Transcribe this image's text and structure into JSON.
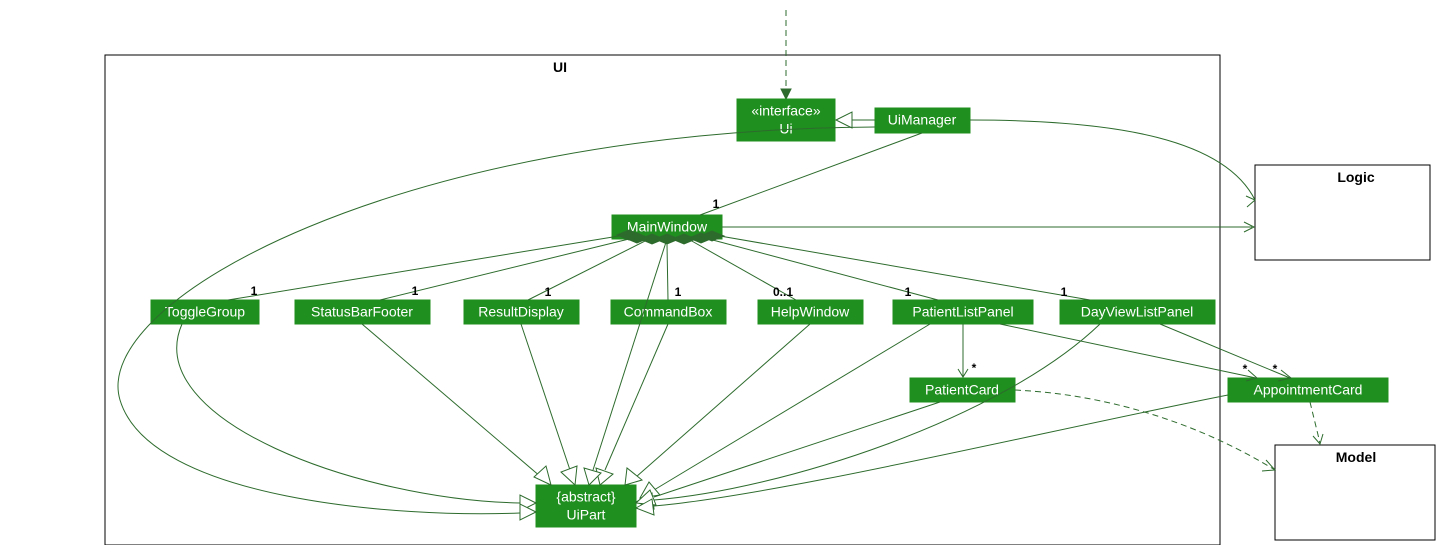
{
  "chart_data": {
    "type": "uml-class-diagram",
    "packages": [
      {
        "id": "UI",
        "label": "UI"
      },
      {
        "id": "Logic",
        "label": "Logic"
      },
      {
        "id": "Model",
        "label": "Model"
      }
    ],
    "classes": [
      {
        "id": "Ui",
        "stereotype": "«interface»",
        "name": "Ui",
        "package": "UI"
      },
      {
        "id": "UiManager",
        "name": "UiManager",
        "package": "UI"
      },
      {
        "id": "MainWindow",
        "name": "MainWindow",
        "package": "UI"
      },
      {
        "id": "ToggleGroup",
        "name": "ToggleGroup",
        "package": "UI"
      },
      {
        "id": "StatusBarFooter",
        "name": "StatusBarFooter",
        "package": "UI"
      },
      {
        "id": "ResultDisplay",
        "name": "ResultDisplay",
        "package": "UI"
      },
      {
        "id": "CommandBox",
        "name": "CommandBox",
        "package": "UI"
      },
      {
        "id": "HelpWindow",
        "name": "HelpWindow",
        "package": "UI"
      },
      {
        "id": "PatientListPanel",
        "name": "PatientListPanel",
        "package": "UI"
      },
      {
        "id": "DayViewListPanel",
        "name": "DayViewListPanel",
        "package": "UI"
      },
      {
        "id": "PatientCard",
        "name": "PatientCard",
        "package": "UI"
      },
      {
        "id": "AppointmentCard",
        "name": "AppointmentCard",
        "package": null
      },
      {
        "id": "UiPart",
        "stereotype": "{abstract}",
        "name": "UiPart",
        "package": "UI"
      }
    ],
    "edges": [
      {
        "from": "outside",
        "to": "Ui",
        "type": "dependency"
      },
      {
        "from": "UiManager",
        "to": "Ui",
        "type": "realization"
      },
      {
        "from": "UiManager",
        "to": "MainWindow",
        "type": "association",
        "mult_to": "1"
      },
      {
        "from": "UiManager",
        "to": "Logic",
        "type": "navigable"
      },
      {
        "from": "MainWindow",
        "to": "Logic",
        "type": "navigable"
      },
      {
        "from": "MainWindow",
        "to": "ToggleGroup",
        "type": "composition",
        "mult_to": "1"
      },
      {
        "from": "MainWindow",
        "to": "StatusBarFooter",
        "type": "composition",
        "mult_to": "1"
      },
      {
        "from": "MainWindow",
        "to": "ResultDisplay",
        "type": "composition",
        "mult_to": "1"
      },
      {
        "from": "MainWindow",
        "to": "CommandBox",
        "type": "composition",
        "mult_to": "1"
      },
      {
        "from": "MainWindow",
        "to": "HelpWindow",
        "type": "composition",
        "mult_to": "0..1"
      },
      {
        "from": "MainWindow",
        "to": "PatientListPanel",
        "type": "composition",
        "mult_to": "1"
      },
      {
        "from": "MainWindow",
        "to": "DayViewListPanel",
        "type": "composition",
        "mult_to": "1"
      },
      {
        "from": "PatientListPanel",
        "to": "PatientCard",
        "type": "navigable",
        "mult_to": "*"
      },
      {
        "from": "PatientListPanel",
        "to": "AppointmentCard",
        "type": "navigable",
        "mult_to": "*"
      },
      {
        "from": "DayViewListPanel",
        "to": "AppointmentCard",
        "type": "navigable",
        "mult_to": "*"
      },
      {
        "from": "PatientCard",
        "to": "Model",
        "type": "dependency"
      },
      {
        "from": "AppointmentCard",
        "to": "Model",
        "type": "dependency"
      },
      {
        "from": "MainWindow",
        "to": "UiPart",
        "type": "generalization"
      },
      {
        "from": "StatusBarFooter",
        "to": "UiPart",
        "type": "generalization"
      },
      {
        "from": "ResultDisplay",
        "to": "UiPart",
        "type": "generalization"
      },
      {
        "from": "CommandBox",
        "to": "UiPart",
        "type": "generalization"
      },
      {
        "from": "HelpWindow",
        "to": "UiPart",
        "type": "generalization"
      },
      {
        "from": "PatientListPanel",
        "to": "UiPart",
        "type": "generalization"
      },
      {
        "from": "DayViewListPanel",
        "to": "UiPart",
        "type": "generalization"
      },
      {
        "from": "PatientCard",
        "to": "UiPart",
        "type": "generalization"
      },
      {
        "from": "AppointmentCard",
        "to": "UiPart",
        "type": "generalization"
      },
      {
        "from": "ToggleGroup",
        "to": "UiPart",
        "type": "generalization"
      },
      {
        "from": "UiManager",
        "to": "UiPart",
        "type": "generalization"
      }
    ]
  },
  "packages": {
    "ui": "UI",
    "logic": "Logic",
    "model": "Model"
  },
  "nodes": {
    "ui_interface_stereo": "«interface»",
    "ui_interface_name": "Ui",
    "uimanager": "UiManager",
    "mainwindow": "MainWindow",
    "togglegroup": "ToggleGroup",
    "statusbarfooter": "StatusBarFooter",
    "resultdisplay": "ResultDisplay",
    "commandbox": "CommandBox",
    "helpwindow": "HelpWindow",
    "patientlistpanel": "PatientListPanel",
    "dayviewlistpanel": "DayViewListPanel",
    "patientcard": "PatientCard",
    "appointmentcard": "AppointmentCard",
    "uipart_stereo": "{abstract}",
    "uipart_name": "UiPart"
  },
  "mults": {
    "mainwindow": "1",
    "togglegroup": "1",
    "statusbarfooter": "1",
    "resultdisplay": "1",
    "commandbox": "1",
    "helpwindow": "0..1",
    "patientlistpanel": "1",
    "dayviewlistpanel": "1",
    "patientcard": "*",
    "appointmentcard_left": "*",
    "appointmentcard_right": "*"
  }
}
